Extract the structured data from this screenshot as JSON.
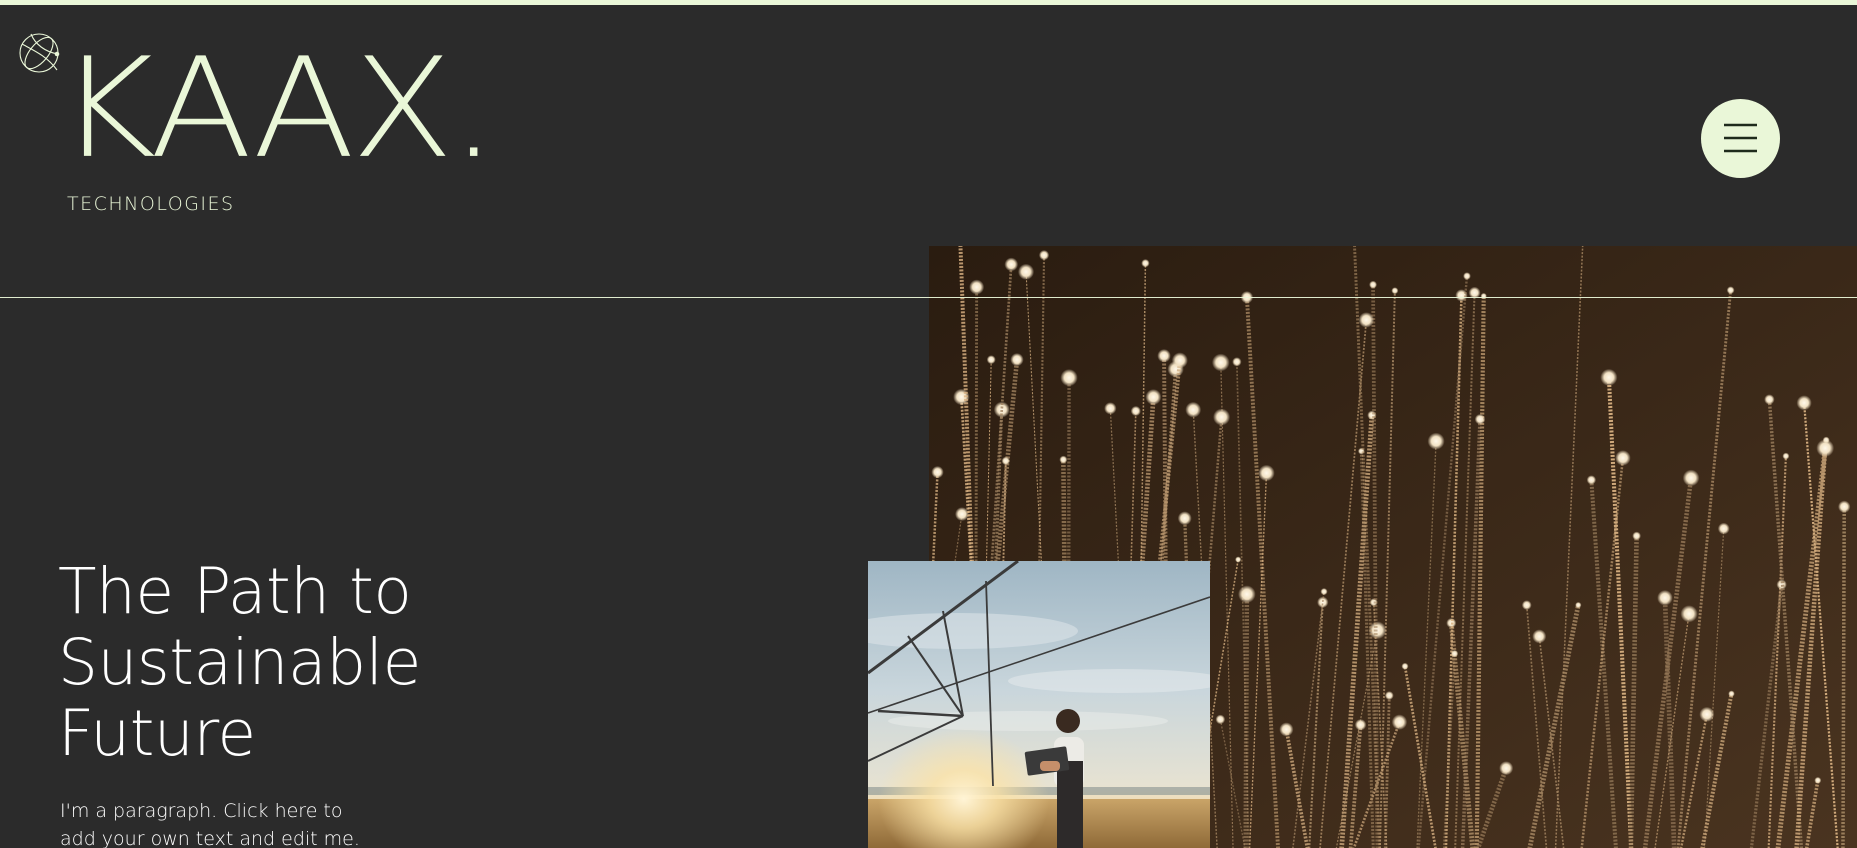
{
  "theme": {
    "background": "#2b2b2b",
    "accent": "#eaf7d8",
    "text": "#ffffff"
  },
  "header": {
    "logo_icon": "globe-orbit-icon",
    "brand_name": "KAAX.",
    "brand_tagline": "TECHNOLOGIES",
    "menu_icon": "hamburger-menu-icon"
  },
  "hero": {
    "headline_lines": [
      "The Path to",
      "Sustainable",
      "Future"
    ],
    "paragraph_lines": [
      "I'm a paragraph. Click here to",
      "add your own text and edit me."
    ],
    "main_image": "fiber-optic-strands-image",
    "secondary_image": "farmer-with-tablet-field-image"
  }
}
